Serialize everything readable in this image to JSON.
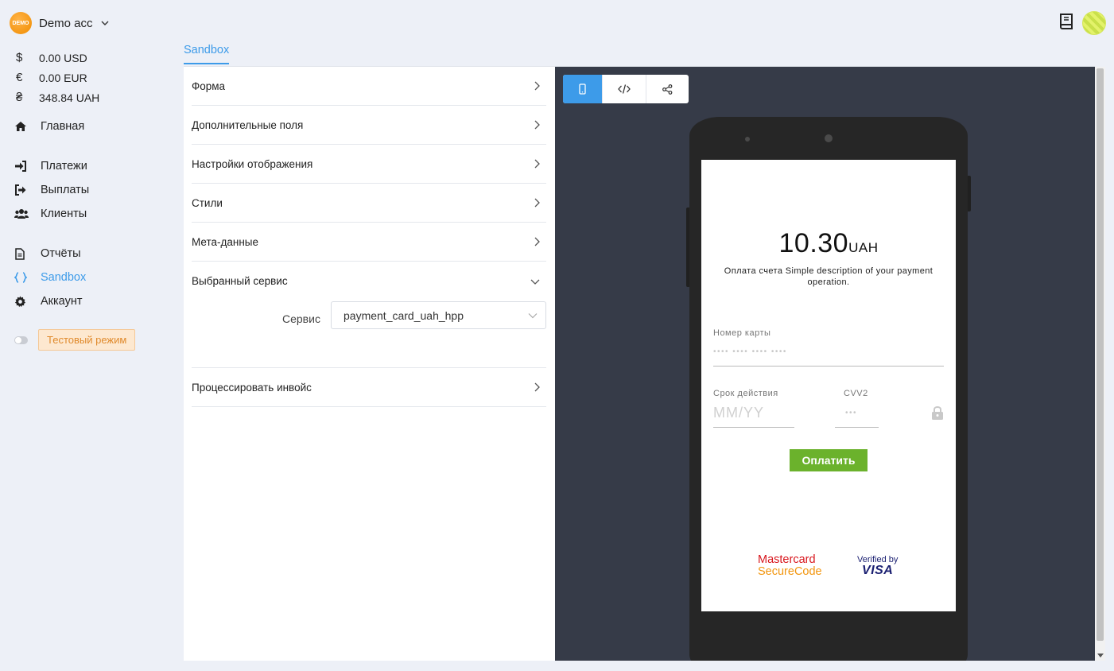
{
  "account": {
    "logo_text": "DEMO",
    "name": "Demo acc"
  },
  "balances": [
    {
      "symbol": "$",
      "amount": "0.00 USD"
    },
    {
      "symbol": "€",
      "amount": "0.00 EUR"
    },
    {
      "symbol": "₴",
      "amount": "348.84 UAH"
    }
  ],
  "nav": {
    "home": "Главная",
    "payments": "Платежи",
    "payouts": "Выплаты",
    "clients": "Клиенты",
    "reports": "Отчёты",
    "sandbox": "Sandbox",
    "account": "Аккаунт"
  },
  "test_mode": {
    "label": "Тестовый режим",
    "enabled": false
  },
  "tabs": {
    "active": "Sandbox"
  },
  "accordion": {
    "form": "Форма",
    "extra_fields": "Дополнительные поля",
    "display_settings": "Настройки отображения",
    "styles": "Стили",
    "metadata": "Мета-данные",
    "selected_service": "Выбранный сервис",
    "process_invoice": "Процессировать инвойс"
  },
  "service": {
    "label": "Сервис",
    "value": "payment_card_uah_hpp"
  },
  "preview": {
    "amount": "10.30",
    "currency": "UAH",
    "description": "Оплата счета Simple description of your payment operation.",
    "card_number_label": "Номер карты",
    "card_number_placeholder": "•••• •••• •••• ••••",
    "expiry_label": "Срок действия",
    "expiry_placeholder": "MM/YY",
    "cvv_label": "CVV2",
    "cvv_placeholder": "•••",
    "pay_button": "Оплатить",
    "mastercard_line1": "Mastercard",
    "mastercard_line2": "SecureCode",
    "visa_line1": "Verified by",
    "visa_line2": "VISA"
  },
  "colors": {
    "accent": "#3d9be9",
    "pay_button": "#6bb22c",
    "preview_bg": "#363b48"
  }
}
